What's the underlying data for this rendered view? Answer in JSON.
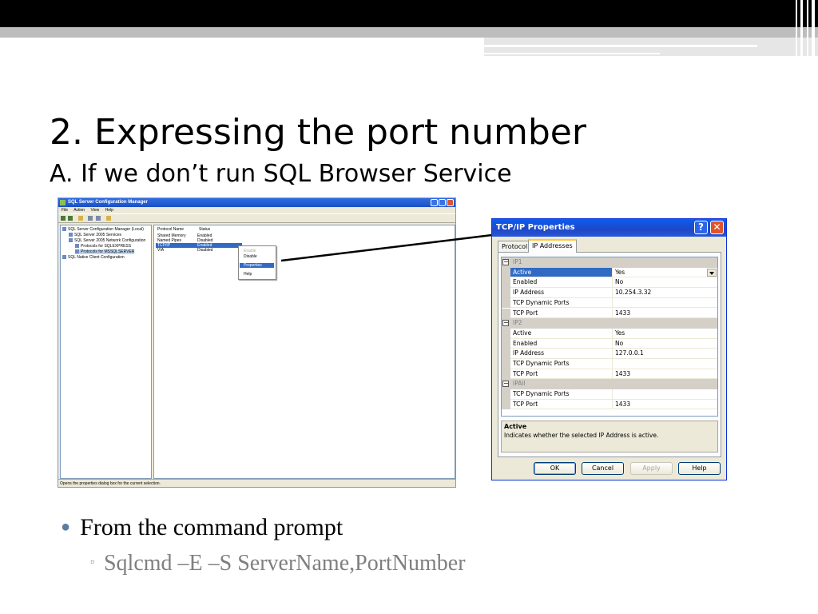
{
  "slide": {
    "title": "2. Expressing the port number",
    "subtitle": "A. If we don’t run SQL Browser Service",
    "bullets": [
      {
        "text": "From the command prompt"
      }
    ],
    "sub_bullets": [
      {
        "text": "Sqlcmd –E –S  ServerName,PortNumber"
      }
    ]
  },
  "config_manager": {
    "title": "SQL Server Configuration Manager",
    "menu": [
      "File",
      "Action",
      "View",
      "Help"
    ],
    "tree": [
      "SQL Server Configuration Manager (Local)",
      "SQL Server 2005 Services",
      "SQL Server 2005 Network Configuration",
      "Protocols for SQLEXPRESS",
      "Protocols for MSSQLSERVER",
      "SQL Native Client Configuration"
    ],
    "columns": [
      "Protocol Name",
      "Status"
    ],
    "rows": [
      {
        "name": "Shared Memory",
        "status": "Enabled"
      },
      {
        "name": "Named Pipes",
        "status": "Disabled"
      },
      {
        "name": "TCP/IP",
        "status": "Enabled"
      },
      {
        "name": "VIA",
        "status": "Disabled"
      }
    ],
    "context_menu": [
      "Enable",
      "Disable",
      "Properties",
      "Help"
    ],
    "status_bar": "Opens the properties dialog box for the current selection."
  },
  "dialog": {
    "title": "TCP/IP Properties",
    "help_glyph": "?",
    "close_glyph": "✕",
    "tabs": [
      "Protocol",
      "IP Addresses"
    ],
    "active_tab": "IP Addresses",
    "groups": [
      {
        "name": "IP1",
        "expander": "−",
        "props": [
          {
            "key": "Active",
            "value": "Yes"
          },
          {
            "key": "Enabled",
            "value": "No"
          },
          {
            "key": "IP Address",
            "value": "10.254.3.32"
          },
          {
            "key": "TCP Dynamic Ports",
            "value": ""
          },
          {
            "key": "TCP Port",
            "value": "1433"
          }
        ]
      },
      {
        "name": "IP2",
        "expander": "−",
        "props": [
          {
            "key": "Active",
            "value": "Yes"
          },
          {
            "key": "Enabled",
            "value": "No"
          },
          {
            "key": "IP Address",
            "value": "127.0.0.1"
          },
          {
            "key": "TCP Dynamic Ports",
            "value": ""
          },
          {
            "key": "TCP Port",
            "value": "1433"
          }
        ]
      },
      {
        "name": "IPAll",
        "expander": "−",
        "props": [
          {
            "key": "TCP Dynamic Ports",
            "value": ""
          },
          {
            "key": "TCP Port",
            "value": "1433"
          }
        ]
      }
    ],
    "description": {
      "title": "Active",
      "text": "Indicates whether the selected IP Address is active."
    },
    "buttons": {
      "ok": "OK",
      "cancel": "Cancel",
      "apply": "Apply",
      "help": "Help"
    }
  },
  "colors": {
    "xp_title_blue": "#1e48c6",
    "selection_blue": "#316ac5",
    "bullet_gray": "#7f7f7f"
  }
}
